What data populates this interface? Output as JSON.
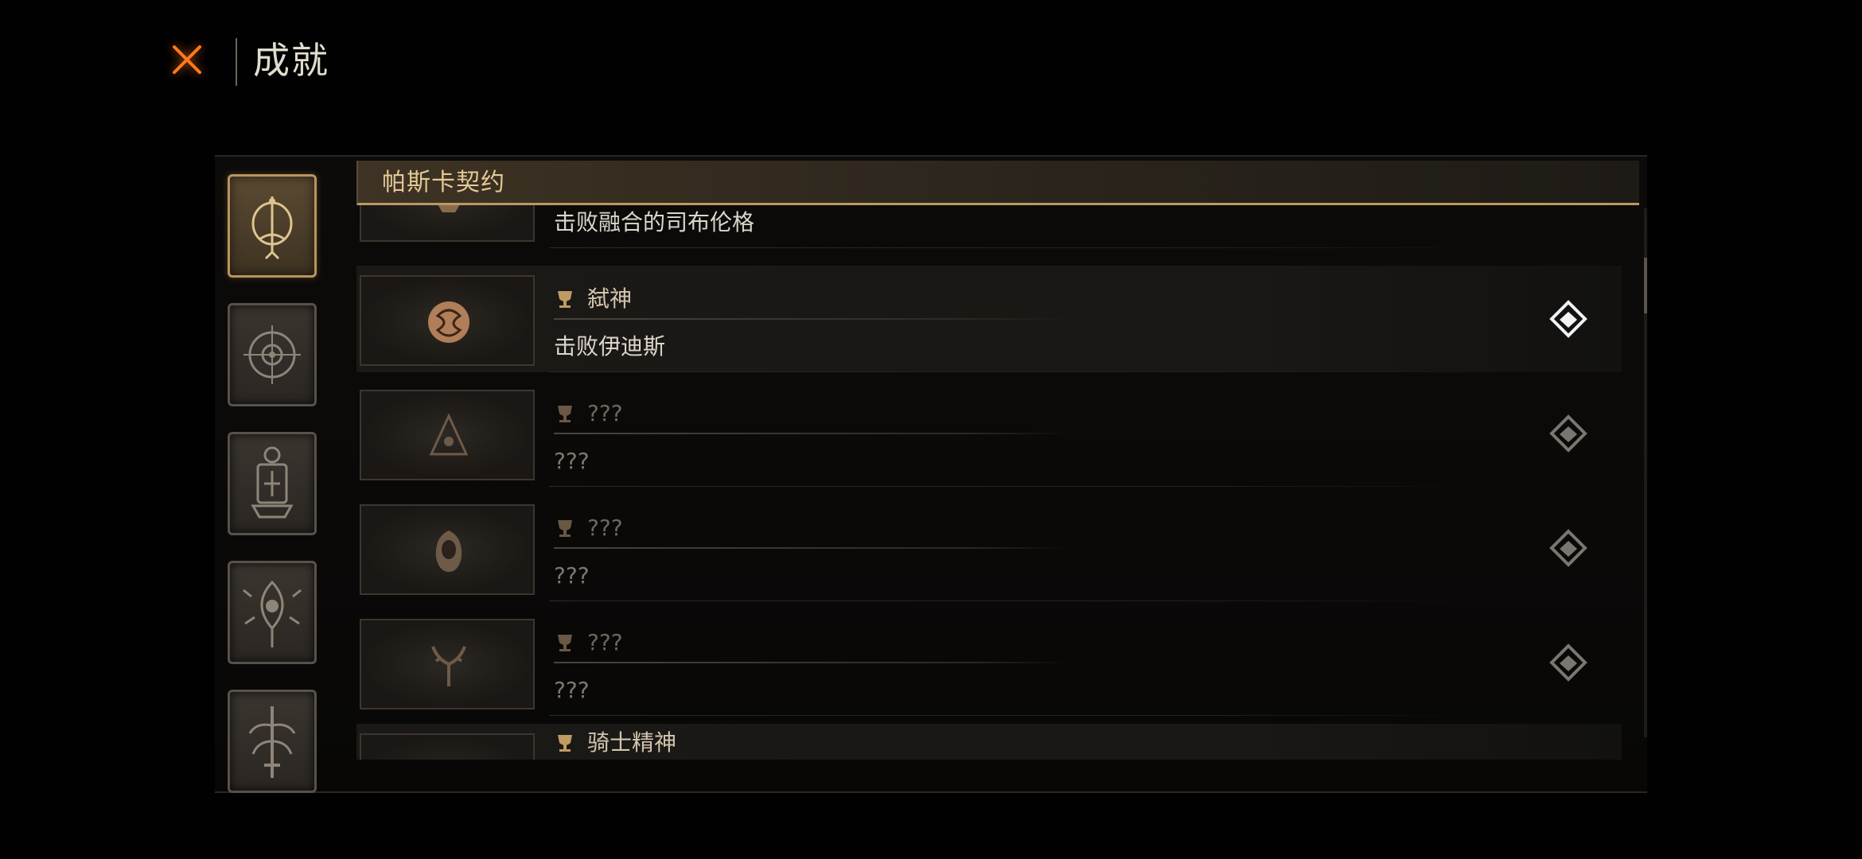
{
  "header": {
    "close_icon": "close-x-icon",
    "title": "成就"
  },
  "sidebar": {
    "categories": [
      {
        "icon": "tab-icon-crown",
        "active": true
      },
      {
        "icon": "tab-icon-eye-compass",
        "active": false
      },
      {
        "icon": "tab-icon-lantern",
        "active": false
      },
      {
        "icon": "tab-icon-thorn-eye",
        "active": false
      },
      {
        "icon": "tab-icon-sword-tree",
        "active": false
      }
    ]
  },
  "section": {
    "title": "帕斯卡契约"
  },
  "achievements": [
    {
      "name": "",
      "description": "击败融合的司布伦格",
      "status": "unlocked"
    },
    {
      "name": "弑神",
      "description": "击败伊迪斯",
      "status": "unlocked"
    },
    {
      "name": "???",
      "description": "???",
      "status": "locked"
    },
    {
      "name": "???",
      "description": "???",
      "status": "locked"
    },
    {
      "name": "???",
      "description": "???",
      "status": "locked"
    },
    {
      "name": "骑士精神",
      "description": "",
      "status": "unlocked"
    }
  ],
  "colors": {
    "accent_gold": "#b99a62",
    "section_title": "#e4c996",
    "close_orange": "#ff7a1e",
    "background": "#010101"
  }
}
